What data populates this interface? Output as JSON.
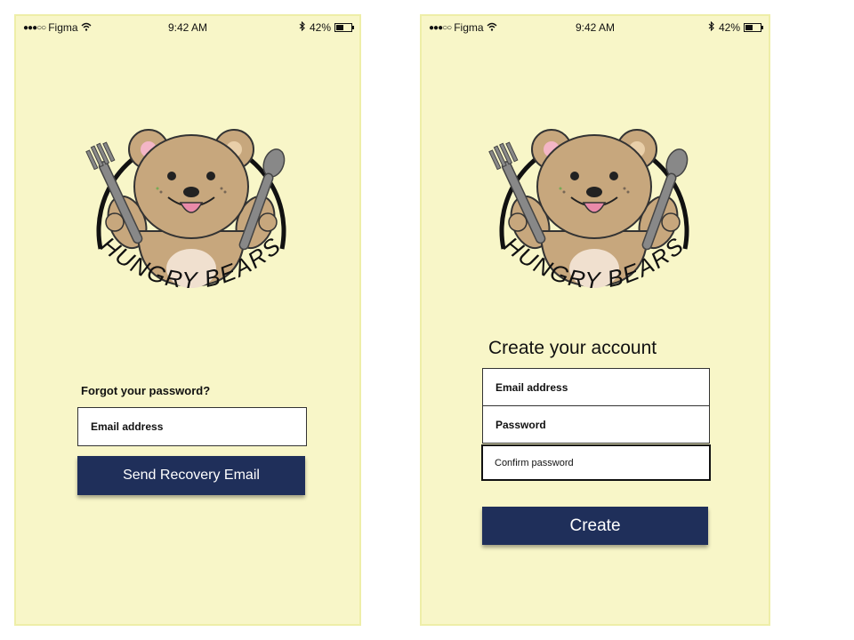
{
  "status_bar": {
    "carrier": "Figma",
    "time": "9:42 AM",
    "battery": "42%",
    "battery_level": 0.42
  },
  "logo": {
    "brand": "HUNGRY BEARS"
  },
  "forgot_screen": {
    "heading": "Forgot your password?",
    "email_label": "Email address",
    "send_button": "Send Recovery Email"
  },
  "create_screen": {
    "heading": "Create your account",
    "email_label": "Email address",
    "password_label": "Password",
    "confirm_label": "Confirm password",
    "create_button": "Create"
  },
  "colors": {
    "screen_bg": "#f8f6c8",
    "button_bg": "#1f2f5a",
    "bear_fur": "#c7a77d",
    "bear_belly": "#f0e0cf",
    "utensil": "#888888"
  }
}
